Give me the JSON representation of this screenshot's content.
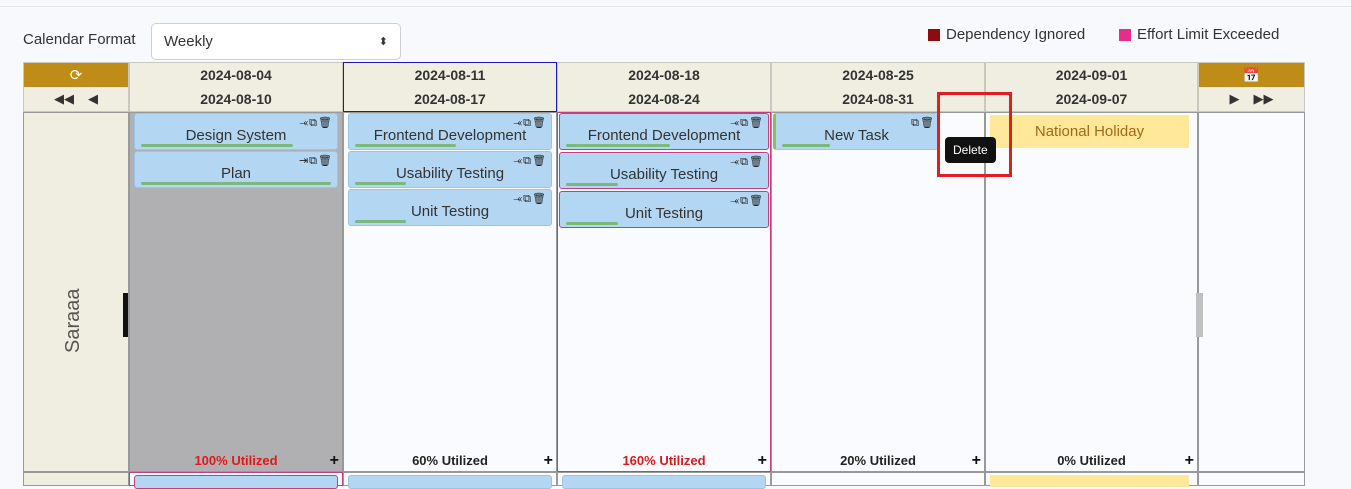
{
  "toolbar": {
    "calendar_format_label": "Calendar Format",
    "calendar_format_value": "Weekly"
  },
  "legend": [
    {
      "label": "Dependency Ignored",
      "color": "#8b0d0d"
    },
    {
      "label": "Effort Limit Exceeded",
      "color": "#e62e87"
    }
  ],
  "weeks": [
    {
      "start": "2024-08-04",
      "end": "2024-08-10"
    },
    {
      "start": "2024-08-11",
      "end": "2024-08-17"
    },
    {
      "start": "2024-08-18",
      "end": "2024-08-24"
    },
    {
      "start": "2024-08-25",
      "end": "2024-08-31"
    },
    {
      "start": "2024-09-01",
      "end": "2024-09-07"
    }
  ],
  "resource": {
    "name": "Saraaa"
  },
  "columns": [
    {
      "utilization": "100% Utilized",
      "tasks": [
        {
          "title": "Design System",
          "progress": 0.75,
          "icons": "⤛⧉🗑"
        },
        {
          "title": "Plan",
          "progress": 0.98,
          "icons": "⇥⧉🗑"
        }
      ]
    },
    {
      "utilization": "60% Utilized",
      "tasks": [
        {
          "title": "Frontend Development",
          "progress": 0.5,
          "icons": "⤛⧉🗑"
        },
        {
          "title": "Usability Testing",
          "progress": 0.25,
          "icons": "⤛⧉🗑"
        },
        {
          "title": "Unit Testing",
          "progress": 0.25,
          "icons": "⤛⧉🗑"
        }
      ]
    },
    {
      "utilization": "160% Utilized",
      "tasks": [
        {
          "title": "Frontend Development",
          "progress": 0.5,
          "icons": "⤛⧉🗑"
        },
        {
          "title": "Usability Testing",
          "progress": 0.25,
          "icons": "⤛⧉🗑"
        },
        {
          "title": "Unit Testing",
          "progress": 0.25,
          "icons": "⤛⧉🗑"
        }
      ]
    },
    {
      "utilization": "20% Utilized",
      "tasks": [
        {
          "title": "New Task",
          "progress": 0.3,
          "icons": "⧉🗑"
        }
      ]
    },
    {
      "utilization": "0% Utilized",
      "holiday": "National Holiday"
    }
  ],
  "tooltip": {
    "text": "Delete"
  }
}
